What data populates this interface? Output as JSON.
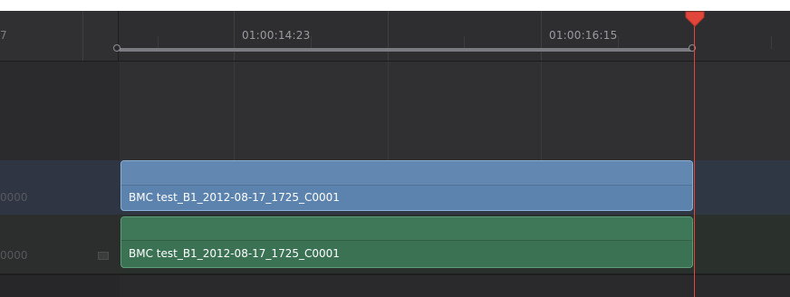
{
  "ruler": {
    "partial_timecode": "7",
    "timecodes": [
      "01:00:14:23",
      "01:00:16:15"
    ]
  },
  "tracks": {
    "video": {
      "header_text": "0000",
      "clip_name": "BMC test_B1_2012-08-17_1725_C0001",
      "clip_color": "#5c83ad"
    },
    "audio": {
      "header_text": "0000",
      "clip_name": "BMC test_B1_2012-08-17_1725_C0001",
      "clip_color": "#3b7254"
    }
  },
  "playhead": {
    "color": "#e2463a"
  },
  "icons": {
    "audio_track_icon": "audio-clip-icon",
    "range_handle_left": "range-handle-icon",
    "range_handle_right": "range-handle-icon"
  }
}
